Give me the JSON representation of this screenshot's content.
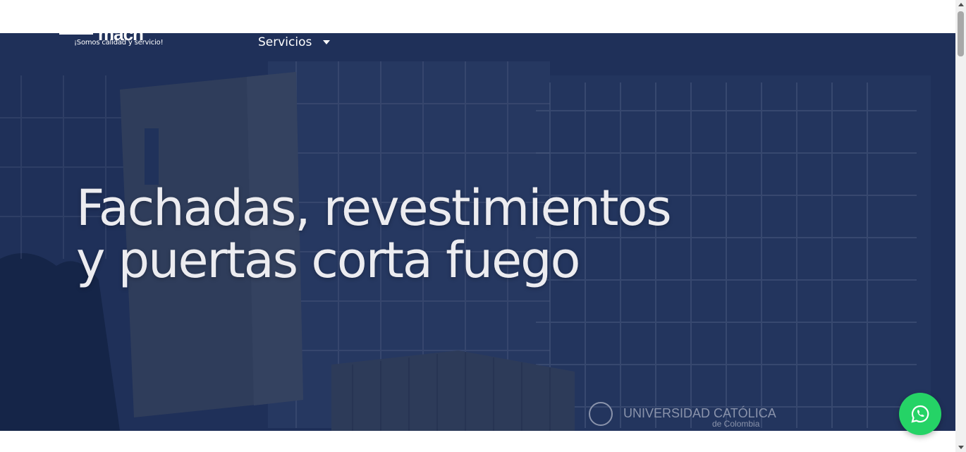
{
  "header": {
    "tagline": "¡Somos calidad y servicio!",
    "logo_text": "macn"
  },
  "nav": {
    "services_label": "Servicios"
  },
  "hero": {
    "title_line1": "Fachadas, revestimientos",
    "title_line2": "y puertas corta fuego",
    "sign_text_1": "UNIVERSIDAD CATÓLICA",
    "sign_text_2": "de Colombia"
  },
  "colors": {
    "overlay": "#1b2d55",
    "whatsapp": "#25d366",
    "text": "#ececf0"
  },
  "icons": {
    "whatsapp": "whatsapp-icon",
    "caret": "chevron-down-icon"
  }
}
